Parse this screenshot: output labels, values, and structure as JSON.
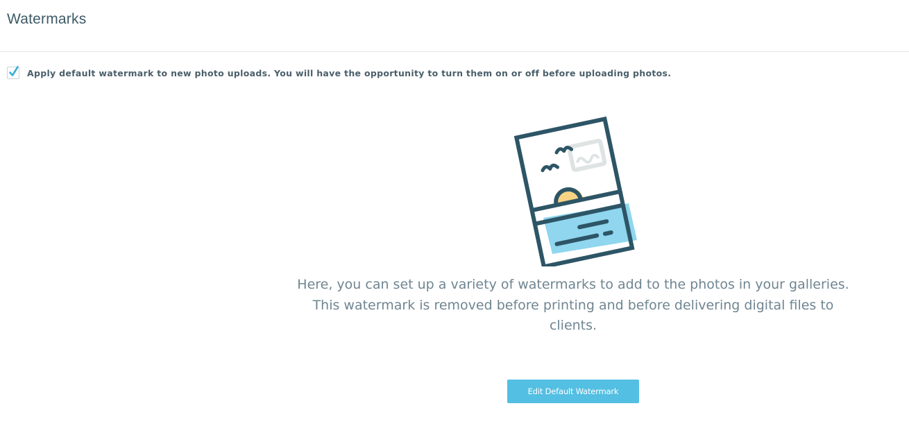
{
  "header": {
    "title": "Watermarks"
  },
  "settings": {
    "apply_default_checked": true,
    "apply_default_label": "Apply default watermark to new photo uploads. You will have the opportunity to turn them on or off before uploading photos."
  },
  "empty_state": {
    "illustration_icon": "photo-watermark-illustration-icon",
    "description": "Here, you can set up a variety of watermarks to add to the photos in your galleries. This watermark is removed before printing and before delivering digital files to clients.",
    "button_label": "Edit Default Watermark"
  },
  "colors": {
    "accent": "#53bfe2",
    "title_text": "#3d5a66",
    "body_text": "#6f8591",
    "illustration_stroke": "#2d5566",
    "illustration_sun": "#f7d483",
    "illustration_water": "#8fd6ee",
    "illustration_mark": "#dde4e3"
  }
}
